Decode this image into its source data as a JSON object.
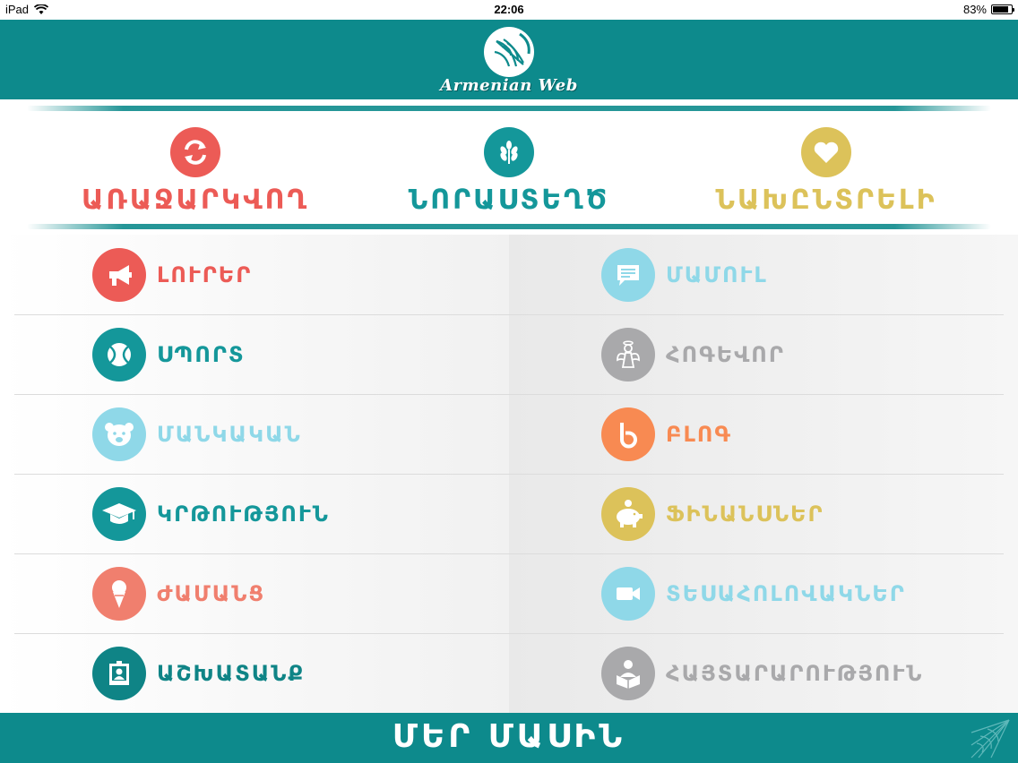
{
  "status_bar": {
    "device": "iPad",
    "time": "22:06",
    "battery": "83%",
    "battery_level": 0.83
  },
  "header": {
    "logo_text": "Armenian Web"
  },
  "top_categories": [
    {
      "label": "ԱՌԱՋԱՐԿՎՈՂ",
      "icon": "refresh-icon",
      "color": "#ec5b56"
    },
    {
      "label": "ՆՈՐԱՍՏԵՂԾ",
      "icon": "wheat-icon",
      "color": "#14979a"
    },
    {
      "label": "ՆԱԽԸՆՏՐԵԼԻ",
      "icon": "heart-icon",
      "color": "#dcc25a"
    }
  ],
  "left_items": [
    {
      "label": "ԼՈՒՐԵՐ",
      "icon": "megaphone-icon",
      "color": "#ec5b56"
    },
    {
      "label": "ՍՊՈՐՏ",
      "icon": "tennis-ball-icon",
      "color": "#14979a"
    },
    {
      "label": "ՄԱՆԿԱԿԱՆ",
      "icon": "teddy-bear-icon",
      "color": "#8fd8e8"
    },
    {
      "label": "ԿՐԹՈՒԹՅՈՒՆ",
      "icon": "graduation-cap-icon",
      "color": "#14979a"
    },
    {
      "label": "ԺԱՄԱՆՑ",
      "icon": "ice-cream-icon",
      "color": "#f07f6e"
    },
    {
      "label": "ԱՇԽԱՏԱՆՔ",
      "icon": "id-badge-icon",
      "color": "#0f8486"
    }
  ],
  "right_items": [
    {
      "label": "ՄԱՄՈՒԼ",
      "icon": "speech-bubble-icon",
      "color": "#8fd8e8"
    },
    {
      "label": "ՀՈԳԵՎՈՐ",
      "icon": "angel-icon",
      "color": "#a9a9ab"
    },
    {
      "label": "ԲԼՈԳ",
      "icon": "blog-b-icon",
      "color": "#f88a52"
    },
    {
      "label": "ՖԻՆԱՆՍՆԵՐ",
      "icon": "piggy-bank-icon",
      "color": "#dcc25a"
    },
    {
      "label": "ՏԵՍԱՀՈԼՈՎԱԿՆԵՐ",
      "icon": "video-camera-icon",
      "color": "#8fd8e8"
    },
    {
      "label": "ՀԱՅՏԱՐԱՐՈՒԹՅՈՒՆ",
      "icon": "reader-icon",
      "color": "#a9a9ab"
    }
  ],
  "footer": {
    "label": "ՄԵՐ ՄԱՍԻՆ",
    "icon": "spider-web-icon"
  },
  "colors": {
    "teal": "#0d8a8c"
  }
}
